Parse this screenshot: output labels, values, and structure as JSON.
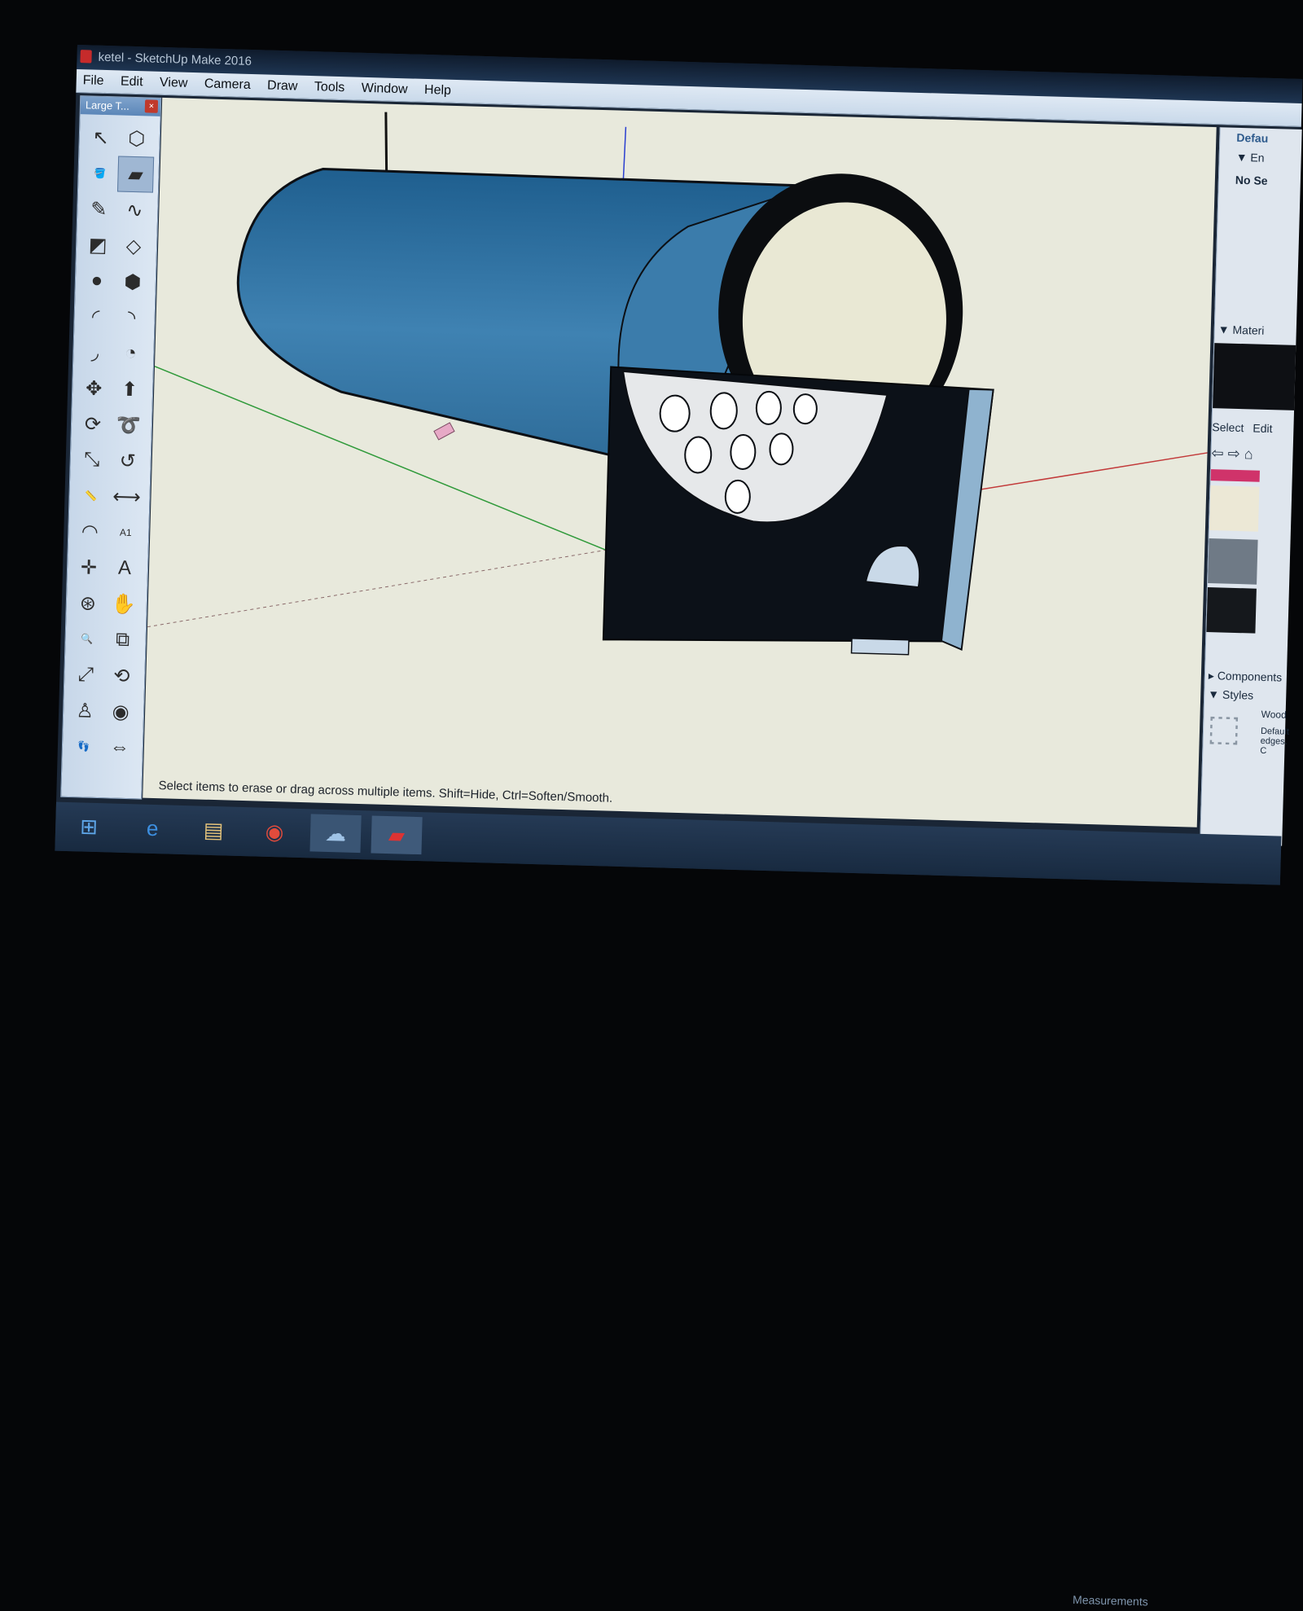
{
  "window": {
    "title": "ketel - SketchUp Make 2016"
  },
  "menu": [
    "File",
    "Edit",
    "View",
    "Camera",
    "Draw",
    "Tools",
    "Window",
    "Help"
  ],
  "toolbar": {
    "title": "Large T...",
    "close": "×"
  },
  "tools": [
    {
      "name": "select-tool-icon",
      "glyph": "↖"
    },
    {
      "name": "make-component-icon",
      "glyph": "⬡"
    },
    {
      "name": "paint-bucket-icon",
      "glyph": "🪣"
    },
    {
      "name": "eraser-icon",
      "glyph": "▰",
      "active": true
    },
    {
      "name": "pencil-icon",
      "glyph": "✎"
    },
    {
      "name": "freehand-icon",
      "glyph": "∿"
    },
    {
      "name": "rectangle-icon",
      "glyph": "◩"
    },
    {
      "name": "rotated-rectangle-icon",
      "glyph": "◇"
    },
    {
      "name": "circle-icon",
      "glyph": "●"
    },
    {
      "name": "polygon-icon",
      "glyph": "⬢"
    },
    {
      "name": "arc-icon",
      "glyph": "◜"
    },
    {
      "name": "two-point-arc-icon",
      "glyph": "◝"
    },
    {
      "name": "three-point-arc-icon",
      "glyph": "◞"
    },
    {
      "name": "pie-icon",
      "glyph": "◔"
    },
    {
      "name": "move-icon",
      "glyph": "✥"
    },
    {
      "name": "push-pull-icon",
      "glyph": "⬆"
    },
    {
      "name": "rotate-icon",
      "glyph": "⟳"
    },
    {
      "name": "follow-me-icon",
      "glyph": "➰"
    },
    {
      "name": "scale-icon",
      "glyph": "⤡"
    },
    {
      "name": "offset-icon",
      "glyph": "↺"
    },
    {
      "name": "tape-measure-icon",
      "glyph": "📏"
    },
    {
      "name": "dimension-icon",
      "glyph": "⟷"
    },
    {
      "name": "protractor-icon",
      "glyph": "◠"
    },
    {
      "name": "text-icon",
      "glyph": "A1"
    },
    {
      "name": "axes-icon",
      "glyph": "✛"
    },
    {
      "name": "3d-text-icon",
      "glyph": "A"
    },
    {
      "name": "orbit-icon",
      "glyph": "⊛"
    },
    {
      "name": "pan-icon",
      "glyph": "✋"
    },
    {
      "name": "zoom-icon",
      "glyph": "🔍"
    },
    {
      "name": "zoom-window-icon",
      "glyph": "⧉"
    },
    {
      "name": "zoom-extents-icon",
      "glyph": "⤢"
    },
    {
      "name": "previous-view-icon",
      "glyph": "⟲"
    },
    {
      "name": "position-camera-icon",
      "glyph": "♙"
    },
    {
      "name": "look-around-icon",
      "glyph": "◉"
    },
    {
      "name": "walk-icon",
      "glyph": "👣"
    },
    {
      "name": "section-plane-icon",
      "glyph": "⇔"
    }
  ],
  "status": {
    "text": "Select items to erase or drag across multiple items. Shift=Hide, Ctrl=Soften/Smooth."
  },
  "right_panel": {
    "tray_title": "Defau",
    "entity_info": "▼ En",
    "no_selection": "No Se",
    "materials_header": "▼ Materi",
    "select_tab": "Select",
    "edit_tab": "Edit",
    "components": "▸ Components",
    "styles": "▼ Styles",
    "style_name": "Wood",
    "style_desc": "Default edges. C"
  },
  "measurements": {
    "label": "Measurements"
  },
  "colors": {
    "swatch_pink": "#d0336a",
    "swatch_cream": "#ece8d6",
    "swatch_gray": "#6f7a86",
    "swatch_dark": "#15181c",
    "model_blue": "#3f7fae"
  }
}
